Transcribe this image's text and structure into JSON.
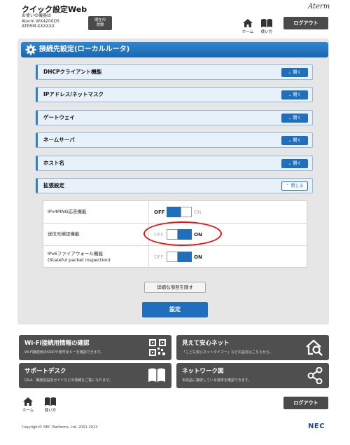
{
  "header": {
    "title": "クイック設定Web",
    "device_lines": [
      "お使いの機器は",
      "Aterm WX4200D5",
      "ATERM-XXXXXX"
    ],
    "status_button": "現在の\n状態",
    "brand": "Aterm",
    "home_label": "ホーム",
    "manual_label": "使い方",
    "logout_label": "ログアウト"
  },
  "panel": {
    "title": "接続先設定(ローカルルータ)",
    "sections": [
      {
        "label": "DHCPクライアント機能",
        "button": "開く"
      },
      {
        "label": "IPアドレス/ネットマスク",
        "button": "開く"
      },
      {
        "label": "ゲートウェイ",
        "button": "開く"
      },
      {
        "label": "ネームサーバ",
        "button": "開く"
      },
      {
        "label": "ホスト名",
        "button": "開く"
      },
      {
        "label": "拡張設定",
        "button": "閉じる"
      }
    ],
    "settings": [
      {
        "label": "IPv4PING応答機能",
        "off": "OFF",
        "on": "ON",
        "state": "off"
      },
      {
        "label": "送信元検証機能",
        "off": "OFF",
        "on": "ON",
        "state": "on"
      },
      {
        "label1": "IPv6ファイアウォール機能",
        "label2": "(Stateful packet inspection)",
        "off": "OFF",
        "on": "ON",
        "state": "on"
      }
    ],
    "detail_button": "詳細な項目を隠す",
    "set_button": "設定"
  },
  "tiles": [
    {
      "title": "Wi-Fi接続用情報の確認",
      "desc": "Wi-Fi接続用のSSIDや暗号化キーを確認できます。",
      "icon": "qr-code-icon"
    },
    {
      "title": "見えて安心ネット",
      "desc": "「こども安心ネットタイマー」などの設定はこちらから。",
      "icon": "house-search-icon"
    },
    {
      "title": "サポートデスク",
      "desc": "Q&A、機能別設定ガイドなどの情報をご覧になれます。",
      "icon": "book-icon"
    },
    {
      "title": "ネットワーク図",
      "desc": "本商品に接続している端末を確認できます。",
      "icon": "network-icon"
    }
  ],
  "footer": {
    "home_label": "ホーム",
    "manual_label": "使い方",
    "logout_label": "ログアウト",
    "copyright": "Copyright© NEC Platforms, Ltd. 2001-2023",
    "nec": "NEC"
  }
}
